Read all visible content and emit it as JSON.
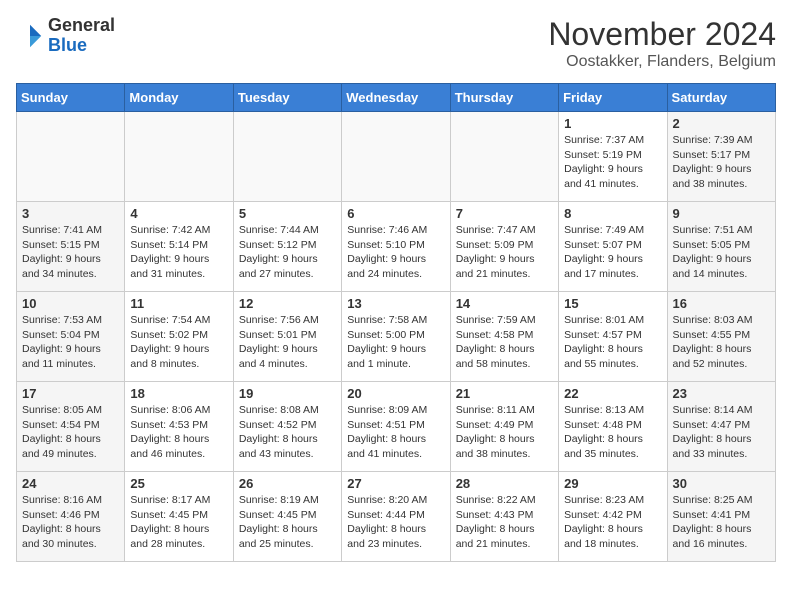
{
  "logo": {
    "general": "General",
    "blue": "Blue"
  },
  "header": {
    "month": "November 2024",
    "location": "Oostakker, Flanders, Belgium"
  },
  "days_of_week": [
    "Sunday",
    "Monday",
    "Tuesday",
    "Wednesday",
    "Thursday",
    "Friday",
    "Saturday"
  ],
  "weeks": [
    [
      {
        "day": "",
        "info": ""
      },
      {
        "day": "",
        "info": ""
      },
      {
        "day": "",
        "info": ""
      },
      {
        "day": "",
        "info": ""
      },
      {
        "day": "",
        "info": ""
      },
      {
        "day": "1",
        "info": "Sunrise: 7:37 AM\nSunset: 5:19 PM\nDaylight: 9 hours\nand 41 minutes."
      },
      {
        "day": "2",
        "info": "Sunrise: 7:39 AM\nSunset: 5:17 PM\nDaylight: 9 hours\nand 38 minutes."
      }
    ],
    [
      {
        "day": "3",
        "info": "Sunrise: 7:41 AM\nSunset: 5:15 PM\nDaylight: 9 hours\nand 34 minutes."
      },
      {
        "day": "4",
        "info": "Sunrise: 7:42 AM\nSunset: 5:14 PM\nDaylight: 9 hours\nand 31 minutes."
      },
      {
        "day": "5",
        "info": "Sunrise: 7:44 AM\nSunset: 5:12 PM\nDaylight: 9 hours\nand 27 minutes."
      },
      {
        "day": "6",
        "info": "Sunrise: 7:46 AM\nSunset: 5:10 PM\nDaylight: 9 hours\nand 24 minutes."
      },
      {
        "day": "7",
        "info": "Sunrise: 7:47 AM\nSunset: 5:09 PM\nDaylight: 9 hours\nand 21 minutes."
      },
      {
        "day": "8",
        "info": "Sunrise: 7:49 AM\nSunset: 5:07 PM\nDaylight: 9 hours\nand 17 minutes."
      },
      {
        "day": "9",
        "info": "Sunrise: 7:51 AM\nSunset: 5:05 PM\nDaylight: 9 hours\nand 14 minutes."
      }
    ],
    [
      {
        "day": "10",
        "info": "Sunrise: 7:53 AM\nSunset: 5:04 PM\nDaylight: 9 hours\nand 11 minutes."
      },
      {
        "day": "11",
        "info": "Sunrise: 7:54 AM\nSunset: 5:02 PM\nDaylight: 9 hours\nand 8 minutes."
      },
      {
        "day": "12",
        "info": "Sunrise: 7:56 AM\nSunset: 5:01 PM\nDaylight: 9 hours\nand 4 minutes."
      },
      {
        "day": "13",
        "info": "Sunrise: 7:58 AM\nSunset: 5:00 PM\nDaylight: 9 hours\nand 1 minute."
      },
      {
        "day": "14",
        "info": "Sunrise: 7:59 AM\nSunset: 4:58 PM\nDaylight: 8 hours\nand 58 minutes."
      },
      {
        "day": "15",
        "info": "Sunrise: 8:01 AM\nSunset: 4:57 PM\nDaylight: 8 hours\nand 55 minutes."
      },
      {
        "day": "16",
        "info": "Sunrise: 8:03 AM\nSunset: 4:55 PM\nDaylight: 8 hours\nand 52 minutes."
      }
    ],
    [
      {
        "day": "17",
        "info": "Sunrise: 8:05 AM\nSunset: 4:54 PM\nDaylight: 8 hours\nand 49 minutes."
      },
      {
        "day": "18",
        "info": "Sunrise: 8:06 AM\nSunset: 4:53 PM\nDaylight: 8 hours\nand 46 minutes."
      },
      {
        "day": "19",
        "info": "Sunrise: 8:08 AM\nSunset: 4:52 PM\nDaylight: 8 hours\nand 43 minutes."
      },
      {
        "day": "20",
        "info": "Sunrise: 8:09 AM\nSunset: 4:51 PM\nDaylight: 8 hours\nand 41 minutes."
      },
      {
        "day": "21",
        "info": "Sunrise: 8:11 AM\nSunset: 4:49 PM\nDaylight: 8 hours\nand 38 minutes."
      },
      {
        "day": "22",
        "info": "Sunrise: 8:13 AM\nSunset: 4:48 PM\nDaylight: 8 hours\nand 35 minutes."
      },
      {
        "day": "23",
        "info": "Sunrise: 8:14 AM\nSunset: 4:47 PM\nDaylight: 8 hours\nand 33 minutes."
      }
    ],
    [
      {
        "day": "24",
        "info": "Sunrise: 8:16 AM\nSunset: 4:46 PM\nDaylight: 8 hours\nand 30 minutes."
      },
      {
        "day": "25",
        "info": "Sunrise: 8:17 AM\nSunset: 4:45 PM\nDaylight: 8 hours\nand 28 minutes."
      },
      {
        "day": "26",
        "info": "Sunrise: 8:19 AM\nSunset: 4:45 PM\nDaylight: 8 hours\nand 25 minutes."
      },
      {
        "day": "27",
        "info": "Sunrise: 8:20 AM\nSunset: 4:44 PM\nDaylight: 8 hours\nand 23 minutes."
      },
      {
        "day": "28",
        "info": "Sunrise: 8:22 AM\nSunset: 4:43 PM\nDaylight: 8 hours\nand 21 minutes."
      },
      {
        "day": "29",
        "info": "Sunrise: 8:23 AM\nSunset: 4:42 PM\nDaylight: 8 hours\nand 18 minutes."
      },
      {
        "day": "30",
        "info": "Sunrise: 8:25 AM\nSunset: 4:41 PM\nDaylight: 8 hours\nand 16 minutes."
      }
    ]
  ]
}
